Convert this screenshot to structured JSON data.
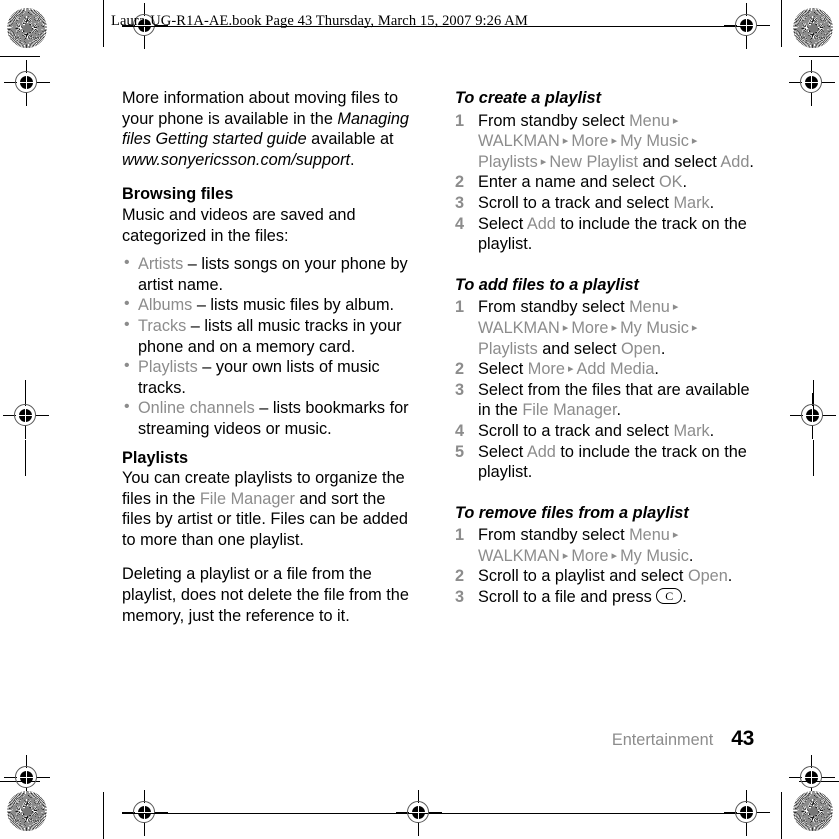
{
  "document": {
    "slug": "Laura-UG-R1A-AE.book  Page 43  Thursday, March 15, 2007  9:26 AM",
    "footer": {
      "chapter": "Entertainment",
      "page_number": "43"
    }
  },
  "marks": {
    "rosette": "rosette-registration-target",
    "registration": "registration-crosshair-mark"
  },
  "left_column": {
    "intro": {
      "t1": "More information about moving files to your phone is available in the ",
      "t2": "Managing files Getting started guide",
      "t3": " available at ",
      "t4": "www.sonyericsson.com/support",
      "t5": "."
    },
    "browsing": {
      "heading": "Browsing files",
      "body": "Music and videos are saved and categorized in the files:",
      "bullets": [
        {
          "term": "Artists",
          "rest": " – lists songs on your phone by artist name."
        },
        {
          "term": "Albums",
          "rest": " – lists music files by album."
        },
        {
          "term": "Tracks",
          "rest": " – lists all music tracks in your phone and on a memory card."
        },
        {
          "term": "Playlists",
          "rest": " – your own lists of music tracks."
        },
        {
          "term": "Online channels",
          "rest": " – lists bookmarks for streaming videos or music."
        }
      ]
    },
    "playlists": {
      "heading": "Playlists",
      "p1_a": "You can create playlists to organize the files in the ",
      "p1_ui": "File Manager",
      "p1_b": " and sort the files by artist or title. Files can be added to more than one playlist.",
      "p2": "Deleting a playlist or a file from the playlist, does not delete the file from the memory, just the reference to it."
    }
  },
  "right_column": {
    "create_playlist": {
      "heading": "To create a playlist",
      "steps": [
        {
          "num": "1",
          "parts": [
            {
              "text": "From standby select ",
              "ui": false
            },
            {
              "text": "Menu",
              "ui": true
            },
            {
              "text": " ▸ ",
              "ui": true
            },
            {
              "text": "WALKMAN",
              "ui": true
            },
            {
              "text": " ▸ ",
              "ui": true
            },
            {
              "text": "More",
              "ui": true
            },
            {
              "text": " ▸ ",
              "ui": true
            },
            {
              "text": "My Music",
              "ui": true
            },
            {
              "text": " ▸ ",
              "ui": true
            },
            {
              "text": "Playlists",
              "ui": true
            },
            {
              "text": " ▸ ",
              "ui": true
            },
            {
              "text": "New Playlist",
              "ui": true
            },
            {
              "text": " and select ",
              "ui": false
            },
            {
              "text": "Add",
              "ui": true
            },
            {
              "text": ".",
              "ui": false
            }
          ]
        },
        {
          "num": "2",
          "parts": [
            {
              "text": "Enter a name and select ",
              "ui": false
            },
            {
              "text": "OK",
              "ui": true
            },
            {
              "text": ".",
              "ui": false
            }
          ]
        },
        {
          "num": "3",
          "parts": [
            {
              "text": "Scroll to a track and select ",
              "ui": false
            },
            {
              "text": "Mark",
              "ui": true
            },
            {
              "text": ".",
              "ui": false
            }
          ]
        },
        {
          "num": "4",
          "parts": [
            {
              "text": "Select ",
              "ui": false
            },
            {
              "text": "Add",
              "ui": true
            },
            {
              "text": " to include the track on the playlist.",
              "ui": false
            }
          ]
        }
      ]
    },
    "add_files": {
      "heading": "To add files to a playlist",
      "steps": [
        {
          "num": "1",
          "parts": [
            {
              "text": "From standby select ",
              "ui": false
            },
            {
              "text": "Menu",
              "ui": true
            },
            {
              "text": " ▸ ",
              "ui": true
            },
            {
              "text": "WALKMAN",
              "ui": true
            },
            {
              "text": " ▸ ",
              "ui": true
            },
            {
              "text": "More",
              "ui": true
            },
            {
              "text": " ▸ ",
              "ui": true
            },
            {
              "text": "My Music",
              "ui": true
            },
            {
              "text": " ▸ ",
              "ui": true
            },
            {
              "text": "Playlists",
              "ui": true
            },
            {
              "text": " and select ",
              "ui": false
            },
            {
              "text": "Open",
              "ui": true
            },
            {
              "text": ".",
              "ui": false
            }
          ]
        },
        {
          "num": "2",
          "parts": [
            {
              "text": "Select ",
              "ui": false
            },
            {
              "text": "More",
              "ui": true
            },
            {
              "text": " ▸ ",
              "ui": true
            },
            {
              "text": "Add Media",
              "ui": true
            },
            {
              "text": ".",
              "ui": false
            }
          ]
        },
        {
          "num": "3",
          "parts": [
            {
              "text": "Select from the files that are available in the ",
              "ui": false
            },
            {
              "text": "File Manager",
              "ui": true
            },
            {
              "text": ".",
              "ui": false
            }
          ]
        },
        {
          "num": "4",
          "parts": [
            {
              "text": "Scroll to a track and select ",
              "ui": false
            },
            {
              "text": "Mark",
              "ui": true
            },
            {
              "text": ".",
              "ui": false
            }
          ]
        },
        {
          "num": "5",
          "parts": [
            {
              "text": "Select ",
              "ui": false
            },
            {
              "text": "Add",
              "ui": true
            },
            {
              "text": " to include the track on the playlist.",
              "ui": false
            }
          ]
        }
      ]
    },
    "remove_files": {
      "heading": "To remove files from a playlist",
      "steps": [
        {
          "num": "1",
          "parts": [
            {
              "text": "From standby select ",
              "ui": false
            },
            {
              "text": "Menu",
              "ui": true
            },
            {
              "text": " ▸ ",
              "ui": true
            },
            {
              "text": "WALKMAN",
              "ui": true
            },
            {
              "text": " ▸ ",
              "ui": true
            },
            {
              "text": "More",
              "ui": true
            },
            {
              "text": " ▸ ",
              "ui": true
            },
            {
              "text": "My Music",
              "ui": true
            },
            {
              "text": ".",
              "ui": false
            }
          ]
        },
        {
          "num": "2",
          "parts": [
            {
              "text": "Scroll to a playlist and select ",
              "ui": false
            },
            {
              "text": "Open",
              "ui": true
            },
            {
              "text": ".",
              "ui": false
            }
          ]
        },
        {
          "num": "3",
          "parts": [
            {
              "text": "Scroll to a file and press ",
              "ui": false
            },
            {
              "text": "__KEY_C__",
              "ui": false
            },
            {
              "text": ".",
              "ui": false
            }
          ]
        }
      ],
      "key_glyph": "C"
    }
  }
}
